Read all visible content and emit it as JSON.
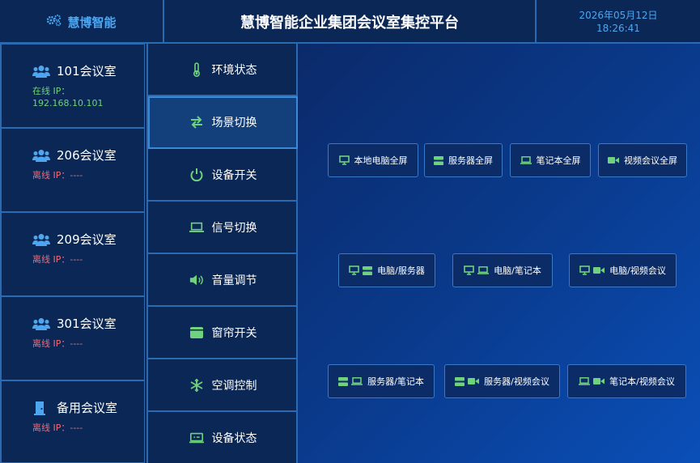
{
  "header": {
    "logo_text": "慧博智能",
    "title": "慧博智能企业集团会议室集控平台",
    "date": "2026年05月12日",
    "time": "18:26:41"
  },
  "rooms": [
    {
      "name": "101会议室",
      "status_label": "在线 IP：",
      "ip": "192.168.10.101",
      "online": true,
      "icon": "users-icon"
    },
    {
      "name": "206会议室",
      "status_label": "离线 IP：----",
      "online": false,
      "icon": "users-icon"
    },
    {
      "name": "209会议室",
      "status_label": "离线 IP：----",
      "online": false,
      "icon": "users-icon"
    },
    {
      "name": "301会议室",
      "status_label": "离线 IP：----",
      "online": false,
      "icon": "users-icon"
    },
    {
      "name": "备用会议室",
      "status_label": "离线 IP：----",
      "online": false,
      "icon": "door-icon"
    }
  ],
  "menu": [
    {
      "label": "环境状态",
      "icon": "thermometer-icon"
    },
    {
      "label": "场景切换",
      "icon": "switch-arrows-icon",
      "active": true
    },
    {
      "label": "设备开关",
      "icon": "power-icon"
    },
    {
      "label": "信号切换",
      "icon": "laptop-icon"
    },
    {
      "label": "音量调节",
      "icon": "volume-icon"
    },
    {
      "label": "窗帘开关",
      "icon": "curtain-icon"
    },
    {
      "label": "空调控制",
      "icon": "snowflake-icon"
    },
    {
      "label": "设备状态",
      "icon": "monitor-status-icon"
    }
  ],
  "scenes": {
    "row1": [
      {
        "label": "本地电脑全屏",
        "icons": [
          "monitor-icon"
        ]
      },
      {
        "label": "服务器全屏",
        "icons": [
          "server-icon"
        ]
      },
      {
        "label": "笔记本全屏",
        "icons": [
          "laptop-icon"
        ]
      },
      {
        "label": "视频会议全屏",
        "icons": [
          "video-icon"
        ]
      }
    ],
    "row2": [
      {
        "label": "电脑/服务器",
        "icons": [
          "monitor-icon",
          "server-icon"
        ]
      },
      {
        "label": "电脑/笔记本",
        "icons": [
          "monitor-icon",
          "laptop-icon"
        ]
      },
      {
        "label": "电脑/视频会议",
        "icons": [
          "monitor-icon",
          "video-icon"
        ]
      }
    ],
    "row3": [
      {
        "label": "服务器/笔记本",
        "icons": [
          "server-icon",
          "laptop-icon"
        ]
      },
      {
        "label": "服务器/视频会议",
        "icons": [
          "server-icon",
          "video-icon"
        ]
      },
      {
        "label": "笔记本/视频会议",
        "icons": [
          "laptop-icon",
          "video-icon"
        ]
      }
    ]
  },
  "colors": {
    "accent_blue": "#4ea6f0",
    "icon_green": "#6fd27c",
    "offline_red": "#f06a78",
    "border": "#2a6ab0"
  }
}
